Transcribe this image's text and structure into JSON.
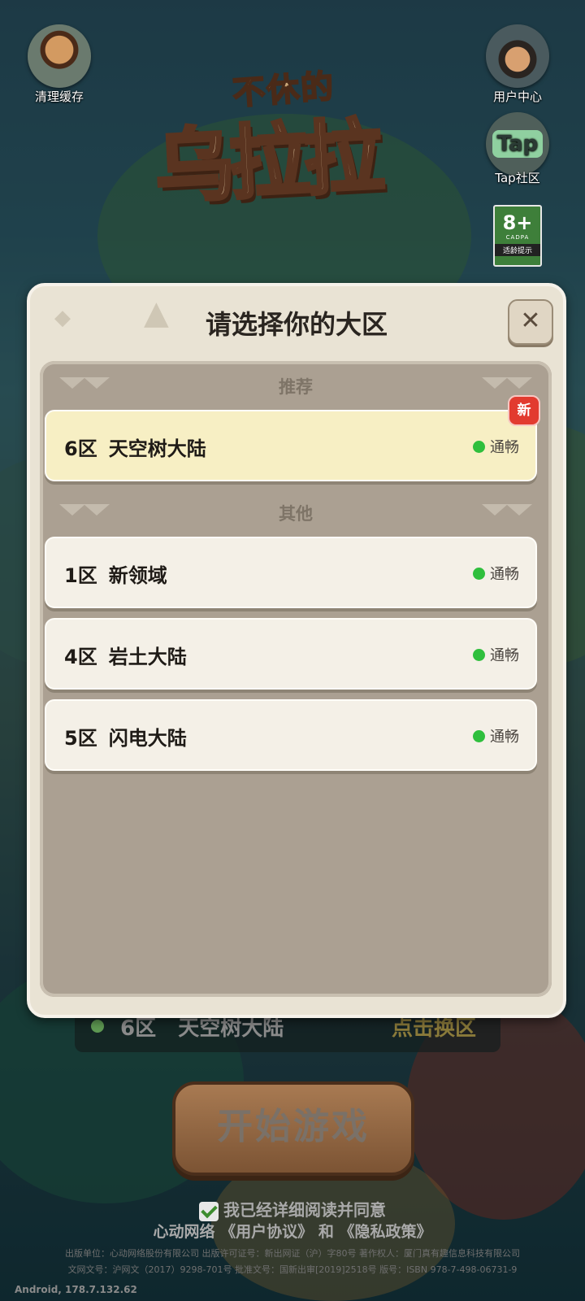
{
  "top_icons": {
    "clear_cache": "清理缓存",
    "user_center": "用户中心",
    "tap_community": "Tap社区",
    "tap_logo": "Tap"
  },
  "logo": {
    "line1": "不休的",
    "line2": "乌拉拉"
  },
  "age_rating": {
    "value": "8+",
    "org": "CADPA",
    "text": "适龄提示"
  },
  "dialog": {
    "title": "请选择你的大区",
    "close_symbol": "✕",
    "recommended_header": "推荐",
    "other_header": "其他",
    "recommended": [
      {
        "zone": "6区",
        "name": "天空树大陆",
        "status": "通畅",
        "badge": "新"
      }
    ],
    "others": [
      {
        "zone": "1区",
        "name": "新领域",
        "status": "通畅"
      },
      {
        "zone": "4区",
        "name": "岩土大陆",
        "status": "通畅"
      },
      {
        "zone": "5区",
        "name": "闪电大陆",
        "status": "通畅"
      }
    ],
    "status_color": "#2fbf3d"
  },
  "server_bar": {
    "current_zone": "6区",
    "current_name": "天空树大陆",
    "switch_label": "点击换区"
  },
  "start_button": "开始游戏",
  "agreement": {
    "checkbox_text": "我已经详细阅读并同意",
    "company": "心动网络",
    "user_agreement": "《用户协议》",
    "and": "和",
    "privacy_policy": "《隐私政策》"
  },
  "legal": {
    "line1": "出版单位：心动网络股份有限公司 出版许可证号：新出网证（沪）字80号 著作权人：厦门真有趣信息科技有限公司",
    "line2": "文网文号：沪网文（2017）9298-701号 批准文号：国新出审[2019]2518号 版号：ISBN 978-7-498-06731-9"
  },
  "version": "Android, 178.7.132.62"
}
